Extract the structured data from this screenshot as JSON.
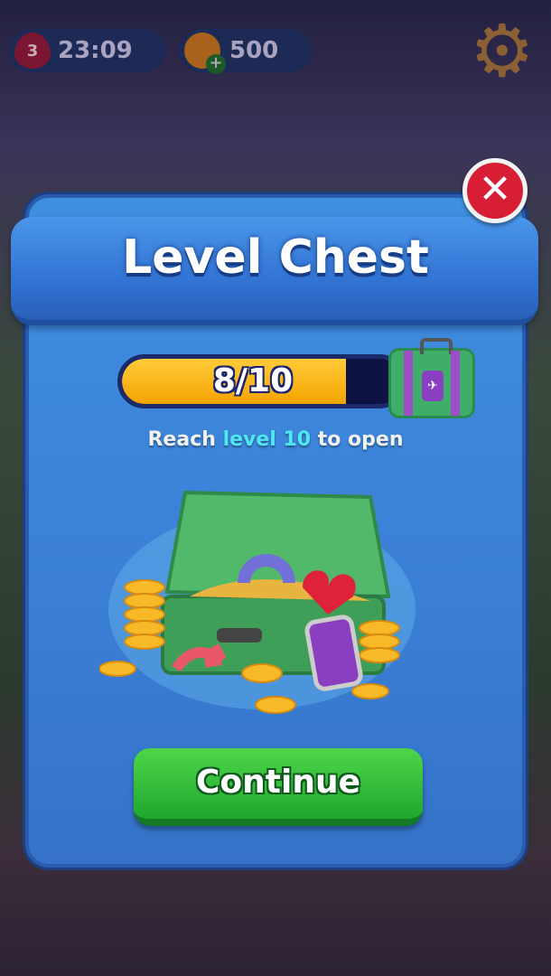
{
  "hud": {
    "lives": "3",
    "life_timer": "23:09",
    "coins": "500"
  },
  "dialog": {
    "title": "Level Chest",
    "progress": {
      "current": 8,
      "total": 10,
      "label": "8/10",
      "fraction": 0.8
    },
    "hint": {
      "prefix": "Reach ",
      "highlight": "level 10",
      "suffix": " to open"
    },
    "continue_label": "Continue",
    "close_symbol": "✕"
  },
  "icons": {
    "settings": "gear-icon",
    "close": "close-icon",
    "lives": "heart-icon",
    "coins": "coin-icon"
  },
  "colors": {
    "panel": "#3b7fd6",
    "progress_fill": "#f5a400",
    "highlight": "#4fe7f0",
    "button": "#1fa72e",
    "close": "#d81e35"
  }
}
